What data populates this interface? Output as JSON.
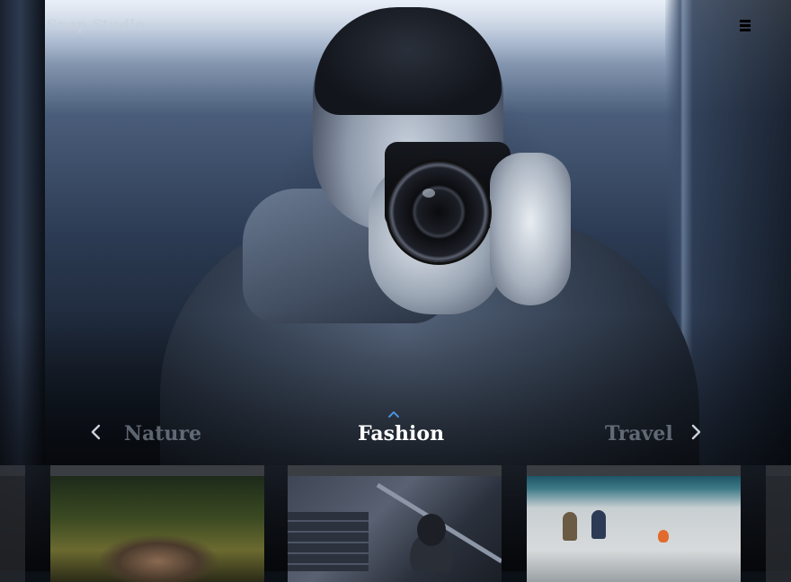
{
  "brand": {
    "name": "Snap Studio"
  },
  "header": {
    "menu_icon": "hamburger-menu-icon"
  },
  "categories": {
    "items": [
      {
        "label": "Nature",
        "active": false
      },
      {
        "label": "Fashion",
        "active": true
      },
      {
        "label": "Travel",
        "active": false
      }
    ],
    "prev_icon": "chevron-left-icon",
    "next_icon": "chevron-right-icon",
    "active_indicator_icon": "chevron-up-icon",
    "active_color": "#ffffff",
    "accent_color": "#4a90d9"
  },
  "thumbnails": {
    "items": [
      {
        "category": "Nature"
      },
      {
        "category": "Fashion"
      },
      {
        "category": "Travel"
      }
    ]
  }
}
